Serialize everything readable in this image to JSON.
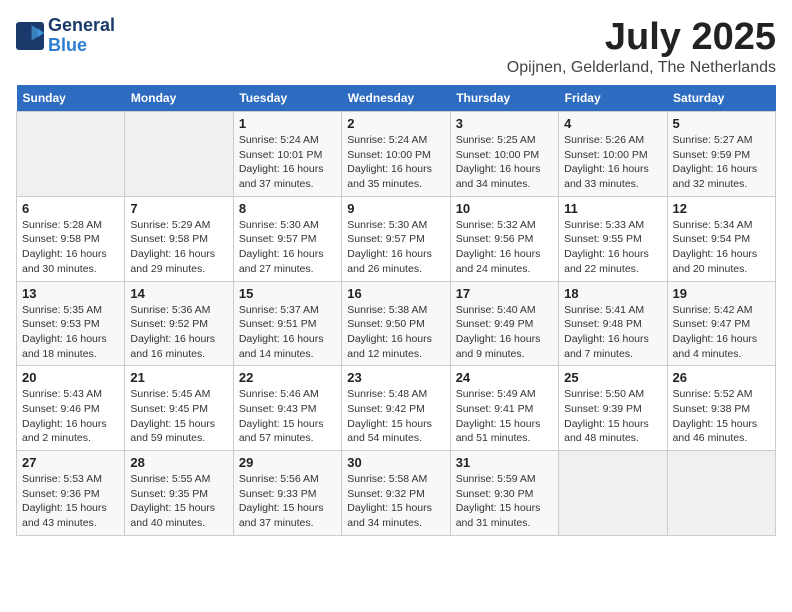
{
  "header": {
    "logo_line1": "General",
    "logo_line2": "Blue",
    "month": "July 2025",
    "location": "Opijnen, Gelderland, The Netherlands"
  },
  "weekdays": [
    "Sunday",
    "Monday",
    "Tuesday",
    "Wednesday",
    "Thursday",
    "Friday",
    "Saturday"
  ],
  "weeks": [
    [
      {
        "day": "",
        "detail": ""
      },
      {
        "day": "",
        "detail": ""
      },
      {
        "day": "1",
        "detail": "Sunrise: 5:24 AM\nSunset: 10:01 PM\nDaylight: 16 hours\nand 37 minutes."
      },
      {
        "day": "2",
        "detail": "Sunrise: 5:24 AM\nSunset: 10:00 PM\nDaylight: 16 hours\nand 35 minutes."
      },
      {
        "day": "3",
        "detail": "Sunrise: 5:25 AM\nSunset: 10:00 PM\nDaylight: 16 hours\nand 34 minutes."
      },
      {
        "day": "4",
        "detail": "Sunrise: 5:26 AM\nSunset: 10:00 PM\nDaylight: 16 hours\nand 33 minutes."
      },
      {
        "day": "5",
        "detail": "Sunrise: 5:27 AM\nSunset: 9:59 PM\nDaylight: 16 hours\nand 32 minutes."
      }
    ],
    [
      {
        "day": "6",
        "detail": "Sunrise: 5:28 AM\nSunset: 9:58 PM\nDaylight: 16 hours\nand 30 minutes."
      },
      {
        "day": "7",
        "detail": "Sunrise: 5:29 AM\nSunset: 9:58 PM\nDaylight: 16 hours\nand 29 minutes."
      },
      {
        "day": "8",
        "detail": "Sunrise: 5:30 AM\nSunset: 9:57 PM\nDaylight: 16 hours\nand 27 minutes."
      },
      {
        "day": "9",
        "detail": "Sunrise: 5:30 AM\nSunset: 9:57 PM\nDaylight: 16 hours\nand 26 minutes."
      },
      {
        "day": "10",
        "detail": "Sunrise: 5:32 AM\nSunset: 9:56 PM\nDaylight: 16 hours\nand 24 minutes."
      },
      {
        "day": "11",
        "detail": "Sunrise: 5:33 AM\nSunset: 9:55 PM\nDaylight: 16 hours\nand 22 minutes."
      },
      {
        "day": "12",
        "detail": "Sunrise: 5:34 AM\nSunset: 9:54 PM\nDaylight: 16 hours\nand 20 minutes."
      }
    ],
    [
      {
        "day": "13",
        "detail": "Sunrise: 5:35 AM\nSunset: 9:53 PM\nDaylight: 16 hours\nand 18 minutes."
      },
      {
        "day": "14",
        "detail": "Sunrise: 5:36 AM\nSunset: 9:52 PM\nDaylight: 16 hours\nand 16 minutes."
      },
      {
        "day": "15",
        "detail": "Sunrise: 5:37 AM\nSunset: 9:51 PM\nDaylight: 16 hours\nand 14 minutes."
      },
      {
        "day": "16",
        "detail": "Sunrise: 5:38 AM\nSunset: 9:50 PM\nDaylight: 16 hours\nand 12 minutes."
      },
      {
        "day": "17",
        "detail": "Sunrise: 5:40 AM\nSunset: 9:49 PM\nDaylight: 16 hours\nand 9 minutes."
      },
      {
        "day": "18",
        "detail": "Sunrise: 5:41 AM\nSunset: 9:48 PM\nDaylight: 16 hours\nand 7 minutes."
      },
      {
        "day": "19",
        "detail": "Sunrise: 5:42 AM\nSunset: 9:47 PM\nDaylight: 16 hours\nand 4 minutes."
      }
    ],
    [
      {
        "day": "20",
        "detail": "Sunrise: 5:43 AM\nSunset: 9:46 PM\nDaylight: 16 hours\nand 2 minutes."
      },
      {
        "day": "21",
        "detail": "Sunrise: 5:45 AM\nSunset: 9:45 PM\nDaylight: 15 hours\nand 59 minutes."
      },
      {
        "day": "22",
        "detail": "Sunrise: 5:46 AM\nSunset: 9:43 PM\nDaylight: 15 hours\nand 57 minutes."
      },
      {
        "day": "23",
        "detail": "Sunrise: 5:48 AM\nSunset: 9:42 PM\nDaylight: 15 hours\nand 54 minutes."
      },
      {
        "day": "24",
        "detail": "Sunrise: 5:49 AM\nSunset: 9:41 PM\nDaylight: 15 hours\nand 51 minutes."
      },
      {
        "day": "25",
        "detail": "Sunrise: 5:50 AM\nSunset: 9:39 PM\nDaylight: 15 hours\nand 48 minutes."
      },
      {
        "day": "26",
        "detail": "Sunrise: 5:52 AM\nSunset: 9:38 PM\nDaylight: 15 hours\nand 46 minutes."
      }
    ],
    [
      {
        "day": "27",
        "detail": "Sunrise: 5:53 AM\nSunset: 9:36 PM\nDaylight: 15 hours\nand 43 minutes."
      },
      {
        "day": "28",
        "detail": "Sunrise: 5:55 AM\nSunset: 9:35 PM\nDaylight: 15 hours\nand 40 minutes."
      },
      {
        "day": "29",
        "detail": "Sunrise: 5:56 AM\nSunset: 9:33 PM\nDaylight: 15 hours\nand 37 minutes."
      },
      {
        "day": "30",
        "detail": "Sunrise: 5:58 AM\nSunset: 9:32 PM\nDaylight: 15 hours\nand 34 minutes."
      },
      {
        "day": "31",
        "detail": "Sunrise: 5:59 AM\nSunset: 9:30 PM\nDaylight: 15 hours\nand 31 minutes."
      },
      {
        "day": "",
        "detail": ""
      },
      {
        "day": "",
        "detail": ""
      }
    ]
  ]
}
